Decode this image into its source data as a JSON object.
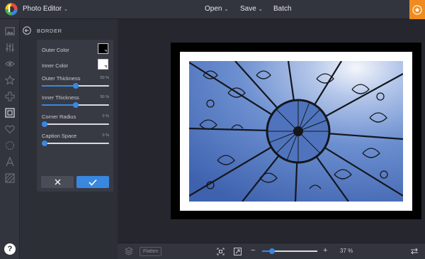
{
  "topbar": {
    "app_title": "Photo Editor",
    "menu_open": "Open",
    "menu_save": "Save",
    "menu_batch": "Batch",
    "chevron": "⌄"
  },
  "colors": {
    "accent_blue": "#3a87e0",
    "accent_orange": "#f08b1f",
    "outer_color": "#000000",
    "inner_color": "#ffffff"
  },
  "rail": {
    "icons": [
      "image-icon",
      "adjust-sliders-icon",
      "eye-icon",
      "star-icon",
      "bandage-icon",
      "frame-icon",
      "heart-icon",
      "shape-icon",
      "text-icon",
      "texture-icon"
    ],
    "help_label": "?"
  },
  "panel": {
    "title": "BORDER",
    "outer_color_label": "Outer Color",
    "inner_color_label": "Inner Color",
    "outer_thickness": {
      "label": "Outer Thickness",
      "value": 50,
      "value_text": "50 %"
    },
    "inner_thickness": {
      "label": "Inner Thickness",
      "value": 50,
      "value_text": "50 %"
    },
    "corner_radius": {
      "label": "Corner Radius",
      "value": 0,
      "value_text": "0 %"
    },
    "caption_space": {
      "label": "Caption Space",
      "value": 0,
      "value_text": "0 %"
    }
  },
  "bottombar": {
    "flatten_label": "Flatten",
    "zoom_value": 37,
    "zoom_text": "37 %",
    "zoom_minus": "−",
    "zoom_plus": "+"
  }
}
